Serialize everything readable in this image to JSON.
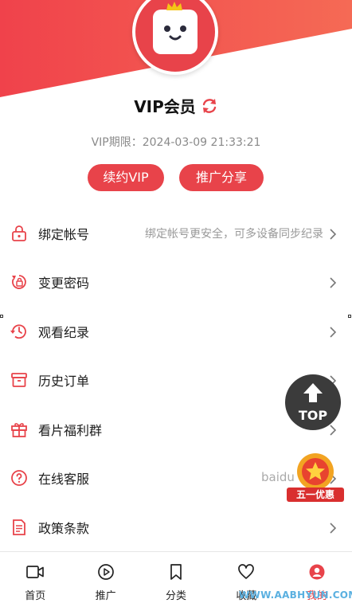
{
  "profile": {
    "title": "VIP会员",
    "expire": "VIP期限：2024-03-09 21:33:21",
    "renew_button": "续约VIP",
    "share_button": "推广分享"
  },
  "menu": [
    {
      "icon": "lock-icon",
      "label": "绑定帐号",
      "hint": "绑定帐号更安全，可多设备同步纪录"
    },
    {
      "icon": "password-icon",
      "label": "变更密码",
      "hint": ""
    },
    {
      "icon": "history-icon",
      "label": "观看纪录",
      "hint": ""
    },
    {
      "icon": "order-box-icon",
      "label": "历史订单",
      "hint": ""
    },
    {
      "icon": "gift-icon",
      "label": "看片福利群",
      "hint": ""
    },
    {
      "icon": "help-circle-icon",
      "label": "在线客服",
      "hint": ""
    },
    {
      "icon": "document-icon",
      "label": "政策条款",
      "hint": ""
    }
  ],
  "floating": {
    "top_label": "TOP",
    "promo_label": "五一优惠",
    "baidu_text": "baidu"
  },
  "tabs": [
    {
      "label": "首页",
      "icon": "video-icon",
      "active": false
    },
    {
      "label": "推广",
      "icon": "play-circle-icon",
      "active": false
    },
    {
      "label": "分类",
      "icon": "bookmark-icon",
      "active": false
    },
    {
      "label": "收藏",
      "icon": "heart-icon",
      "active": false
    },
    {
      "label": "我的",
      "icon": "user-circle-icon",
      "active": true
    }
  ],
  "watermark": "WWW.AABHYUN.COM",
  "colors": {
    "accent": "#e8434a",
    "text": "#1d1d1d",
    "muted": "#999999"
  }
}
